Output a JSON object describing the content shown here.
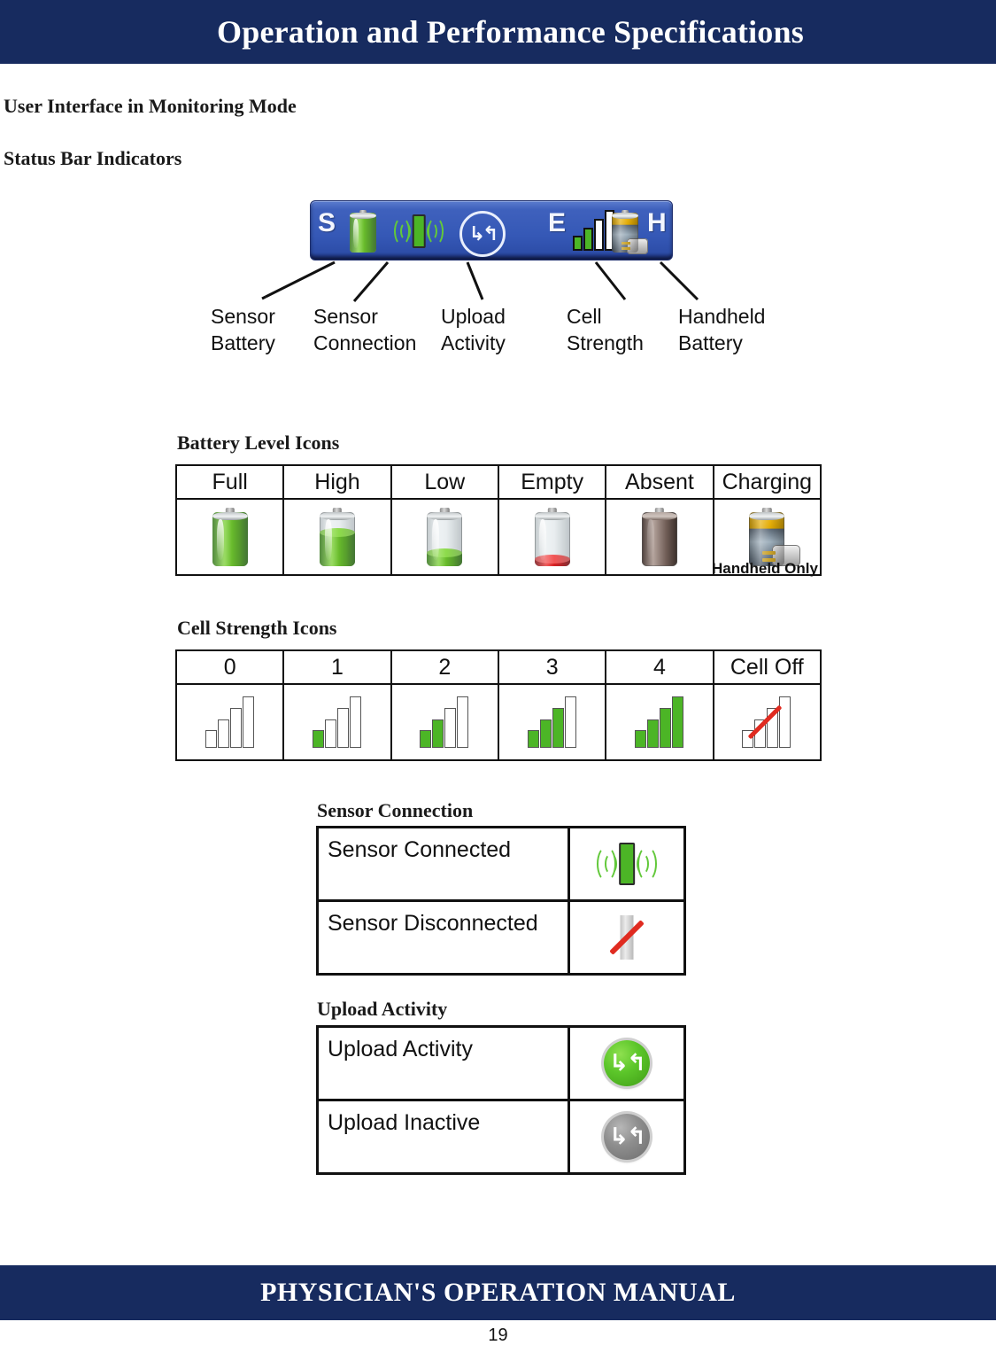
{
  "header": {
    "title": "Operation and Performance Specifications"
  },
  "footer": {
    "title": "PHYSICIAN'S OPERATION MANUAL",
    "page_number": "19"
  },
  "sections": {
    "user_interface": "User Interface in Monitoring Mode",
    "status_bar": "Status Bar Indicators",
    "battery_level": "Battery Level Icons",
    "cell_strength": "Cell Strength Icons",
    "sensor_connection": "Sensor Connection",
    "upload_activity": "Upload Activity"
  },
  "status_bar": {
    "left_label": "S",
    "middle_label": "E",
    "right_label": "H",
    "icons": [
      "sensor-battery-icon",
      "sensor-connection-icon",
      "upload-activity-icon",
      "cell-strength-icon",
      "handheld-battery-icon"
    ],
    "background_color": "#3558b6",
    "callouts": [
      {
        "label": "Sensor\nBattery",
        "icon": "sensor-battery-icon"
      },
      {
        "label": "Sensor\nConnection",
        "icon": "sensor-connection-icon"
      },
      {
        "label": "Upload\nActivity",
        "icon": "upload-activity-icon"
      },
      {
        "label": "Cell\nStrength",
        "icon": "cell-strength-icon"
      },
      {
        "label": "Handheld\nBattery",
        "icon": "handheld-battery-icon"
      }
    ]
  },
  "battery_table": {
    "headers": [
      "Full",
      "High",
      "Low",
      "Empty",
      "Absent",
      "Charging"
    ],
    "note": "Handheld Only",
    "levels": [
      100,
      62,
      22,
      8,
      0,
      0
    ],
    "fill_colors": [
      "#4cb526",
      "#4cb526",
      "#4cb526",
      "#d62525",
      "none",
      "none"
    ]
  },
  "cell_table": {
    "headers": [
      "0",
      "1",
      "2",
      "3",
      "4",
      "Cell Off"
    ],
    "active_bars": [
      0,
      1,
      2,
      3,
      4,
      0
    ],
    "active_color": "#4cb526"
  },
  "sensor_table": {
    "rows": [
      {
        "label": "Sensor Connected",
        "icon": "sensor-connected-icon"
      },
      {
        "label": "Sensor Disconnected",
        "icon": "sensor-disconnected-icon"
      }
    ]
  },
  "upload_table": {
    "rows": [
      {
        "label": "Upload Activity",
        "icon": "upload-active-icon"
      },
      {
        "label": "Upload Inactive",
        "icon": "upload-inactive-icon"
      }
    ]
  },
  "colors": {
    "brand_navy": "#172b5f",
    "green": "#4cb526",
    "red": "#e02b20",
    "status_bar_blue": "#3558b6"
  }
}
